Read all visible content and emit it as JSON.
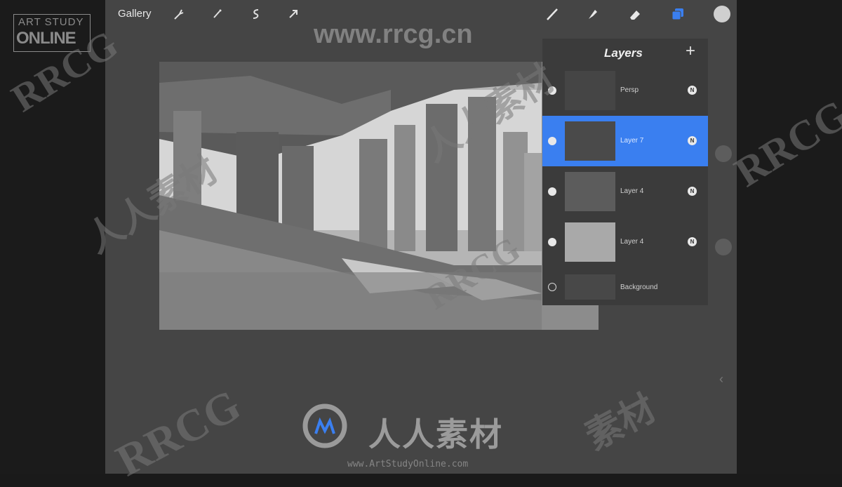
{
  "toolbar": {
    "gallery_label": "Gallery",
    "left_icons": [
      "wrench-icon",
      "magic-wand-icon",
      "selection-icon",
      "move-arrow-icon"
    ],
    "right_icons": [
      "brush-icon",
      "smudge-icon",
      "eraser-icon",
      "layers-icon",
      "color-swatch-icon"
    ],
    "accent_color": "#3a7ff0"
  },
  "layers": {
    "title": "Layers",
    "add_label": "+",
    "items": [
      {
        "name": "Persp",
        "visible": true,
        "mode": "N",
        "selected": false
      },
      {
        "name": "Layer 7",
        "visible": true,
        "mode": "N",
        "selected": true
      },
      {
        "name": "Layer 4",
        "visible": true,
        "mode": "N",
        "selected": false
      },
      {
        "name": "Layer 4",
        "visible": true,
        "mode": "N",
        "selected": false
      },
      {
        "name": "Background",
        "visible": false,
        "mode": "",
        "selected": false
      }
    ]
  },
  "side": {
    "chevron": "‹"
  },
  "watermarks": {
    "top_url": "www.rrcg.cn",
    "logo_line1": "ART STUDY",
    "logo_line2": "ONLINE",
    "bottom_cn": "人人素材",
    "bottom_url": "www.ArtStudyOnline.com",
    "diag_rrcg": "RRCG",
    "diag_cn": "人人素材",
    "diag_cn_short": "素材"
  }
}
